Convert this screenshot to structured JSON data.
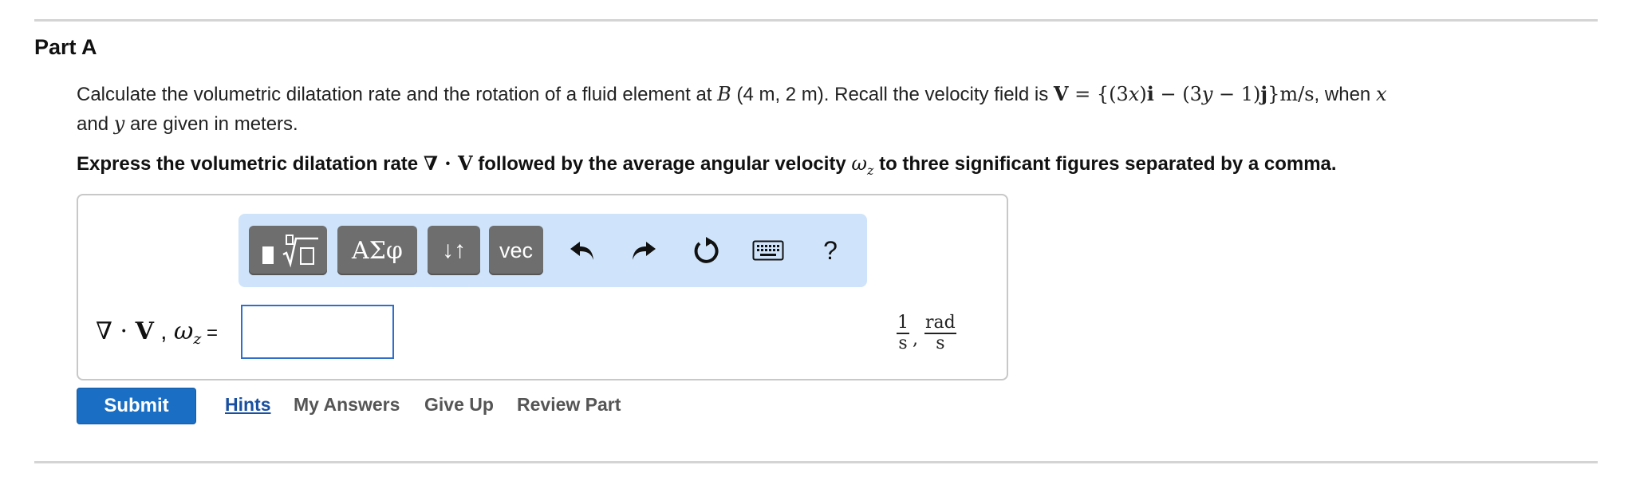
{
  "part_title": "Part A",
  "problem": {
    "t1": "Calculate the volumetric dilatation rate and the rotation of a fluid element at ",
    "B": "B",
    "t2": " (4 m, 2 m). Recall the velocity field is ",
    "V": "V",
    "eq": " = {(3",
    "x1": "x",
    "eq2": ")",
    "i": "i",
    "eq3": " − (3",
    "y1": "y",
    "eq4": " − 1)",
    "j": "j",
    "eq5": "}m/s",
    "t3": ", when ",
    "x2": "x",
    "t4": " and ",
    "y2": "y",
    "t5": " are given in meters."
  },
  "instruction": {
    "t1": "Express the volumetric dilatation rate ",
    "nabla": "∇ · ",
    "V": "V",
    "t2": " followed by the average angular velocity ",
    "omega": "ω",
    "omega_sub": "z",
    "t3": " to three significant figures separated by a comma."
  },
  "toolbar": {
    "templates_icon": "templates-sqrt-icon",
    "greek_label": "ΑΣφ",
    "arrows_label": "↓↑",
    "vec_label": "vec",
    "undo_icon": "undo-icon",
    "redo_icon": "redo-icon",
    "reset_icon": "reset-icon",
    "keyboard_icon": "keyboard-icon",
    "help_label": "?"
  },
  "answer": {
    "label_nabla": "∇ · ",
    "label_V": "V",
    "label_comma": " , ",
    "label_omega": "ω",
    "label_sub": "z",
    "label_eq": " =",
    "value": "",
    "placeholder": ""
  },
  "units": {
    "u1_num": "1",
    "u1_den": "s",
    "sep": ",",
    "u2_num": "rad",
    "u2_den": "s"
  },
  "actions": {
    "submit": "Submit",
    "hints": "Hints",
    "my_answers": "My Answers",
    "give_up": "Give Up",
    "review_part": "Review Part"
  },
  "colors": {
    "toolbar_bg": "#cfe4fa",
    "submit_bg": "#1a6fc4",
    "link_color": "#1a4fa0",
    "input_border": "#2f6fc9"
  }
}
